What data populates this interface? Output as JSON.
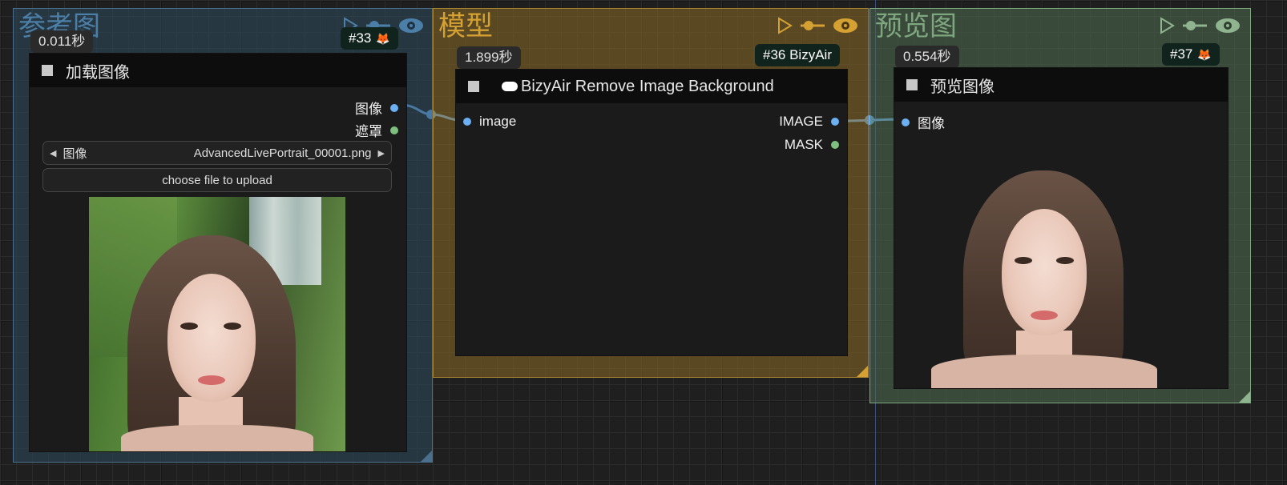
{
  "groups": {
    "ref": {
      "title": "参考图"
    },
    "model": {
      "title": "模型"
    },
    "preview": {
      "title": "预览图"
    }
  },
  "nodes": {
    "load_image": {
      "timer": "0.011秒",
      "badge": "#33",
      "title": "加载图像",
      "outputs": [
        "图像",
        "遮罩"
      ],
      "combo_label": "图像",
      "combo_value": "AdvancedLivePortrait_00001.png",
      "upload_label": "choose file to upload"
    },
    "remove_bg": {
      "timer": "1.899秒",
      "badge": "#36 BizyAir",
      "title": "BizyAir Remove Image Background",
      "inputs": [
        "image"
      ],
      "outputs": [
        "IMAGE",
        "MASK"
      ]
    },
    "preview": {
      "timer": "0.554秒",
      "badge": "#37",
      "title": "预览图像",
      "inputs": [
        "图像"
      ]
    }
  },
  "colors": {
    "ref_group": "#2e4a5e",
    "model_group": "#8a6a24",
    "preview_group": "#4f6b50",
    "link": "#6ab0f3"
  },
  "icons": [
    "play-icon",
    "bypass-icon",
    "eye-icon",
    "fox-icon",
    "cloud-icon"
  ]
}
